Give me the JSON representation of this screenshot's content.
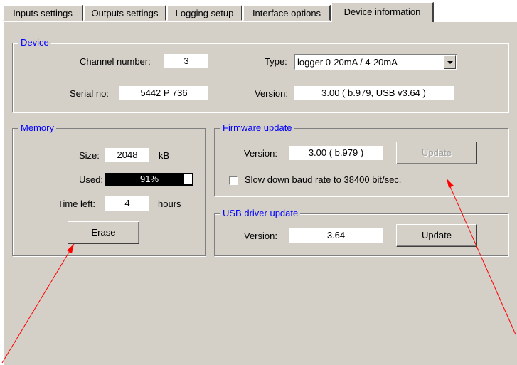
{
  "tabs": [
    {
      "label": "Inputs settings"
    },
    {
      "label": "Outputs settings"
    },
    {
      "label": "Logging setup"
    },
    {
      "label": "Interface options"
    },
    {
      "label": "Device information"
    }
  ],
  "device": {
    "legend": "Device",
    "channel_label": "Channel number:",
    "channel_value": "3",
    "serial_label": "Serial no:",
    "serial_value": "5442 P 736",
    "type_label": "Type:",
    "type_value": "logger  0-20mA / 4-20mA",
    "version_label": "Version:",
    "version_value": "3.00  ( b.979, USB v3.64 )"
  },
  "memory": {
    "legend": "Memory",
    "size_label": "Size:",
    "size_value": "2048",
    "size_unit": "kB",
    "used_label": "Used:",
    "used_value": "91%",
    "used_fraction": 0.91,
    "time_label": "Time left:",
    "time_value": "4",
    "time_unit": "hours",
    "erase_label": "Erase"
  },
  "firmware": {
    "legend": "Firmware update",
    "version_label": "Version:",
    "version_value": "3.00  ( b.979 )",
    "update_label": "Update",
    "update_enabled": false,
    "slow_baud_label": "Slow down baud rate to 38400 bit/sec.",
    "slow_baud_checked": false
  },
  "usb": {
    "legend": "USB driver update",
    "version_label": "Version:",
    "version_value": "3.64",
    "update_label": "Update"
  },
  "annotation_color": "#ff0000"
}
